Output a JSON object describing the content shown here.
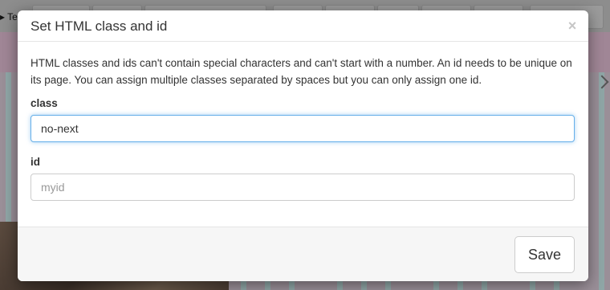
{
  "background": {
    "toolbar_label": "▸ Te"
  },
  "dialog": {
    "title": "Set HTML class and id",
    "close_symbol": "×",
    "help_text": "HTML classes and ids can't contain special characters and can't start with a number. An id needs to be unique on its page. You can assign multiple classes separated by spaces but you can only assign one id.",
    "class_field": {
      "label": "class",
      "value": "no-next",
      "focused": true
    },
    "id_field": {
      "label": "id",
      "value": "",
      "placeholder": "myid"
    },
    "save_label": "Save"
  },
  "colors": {
    "focus_border": "#66afe9",
    "overlay": "#8c8c8c"
  }
}
